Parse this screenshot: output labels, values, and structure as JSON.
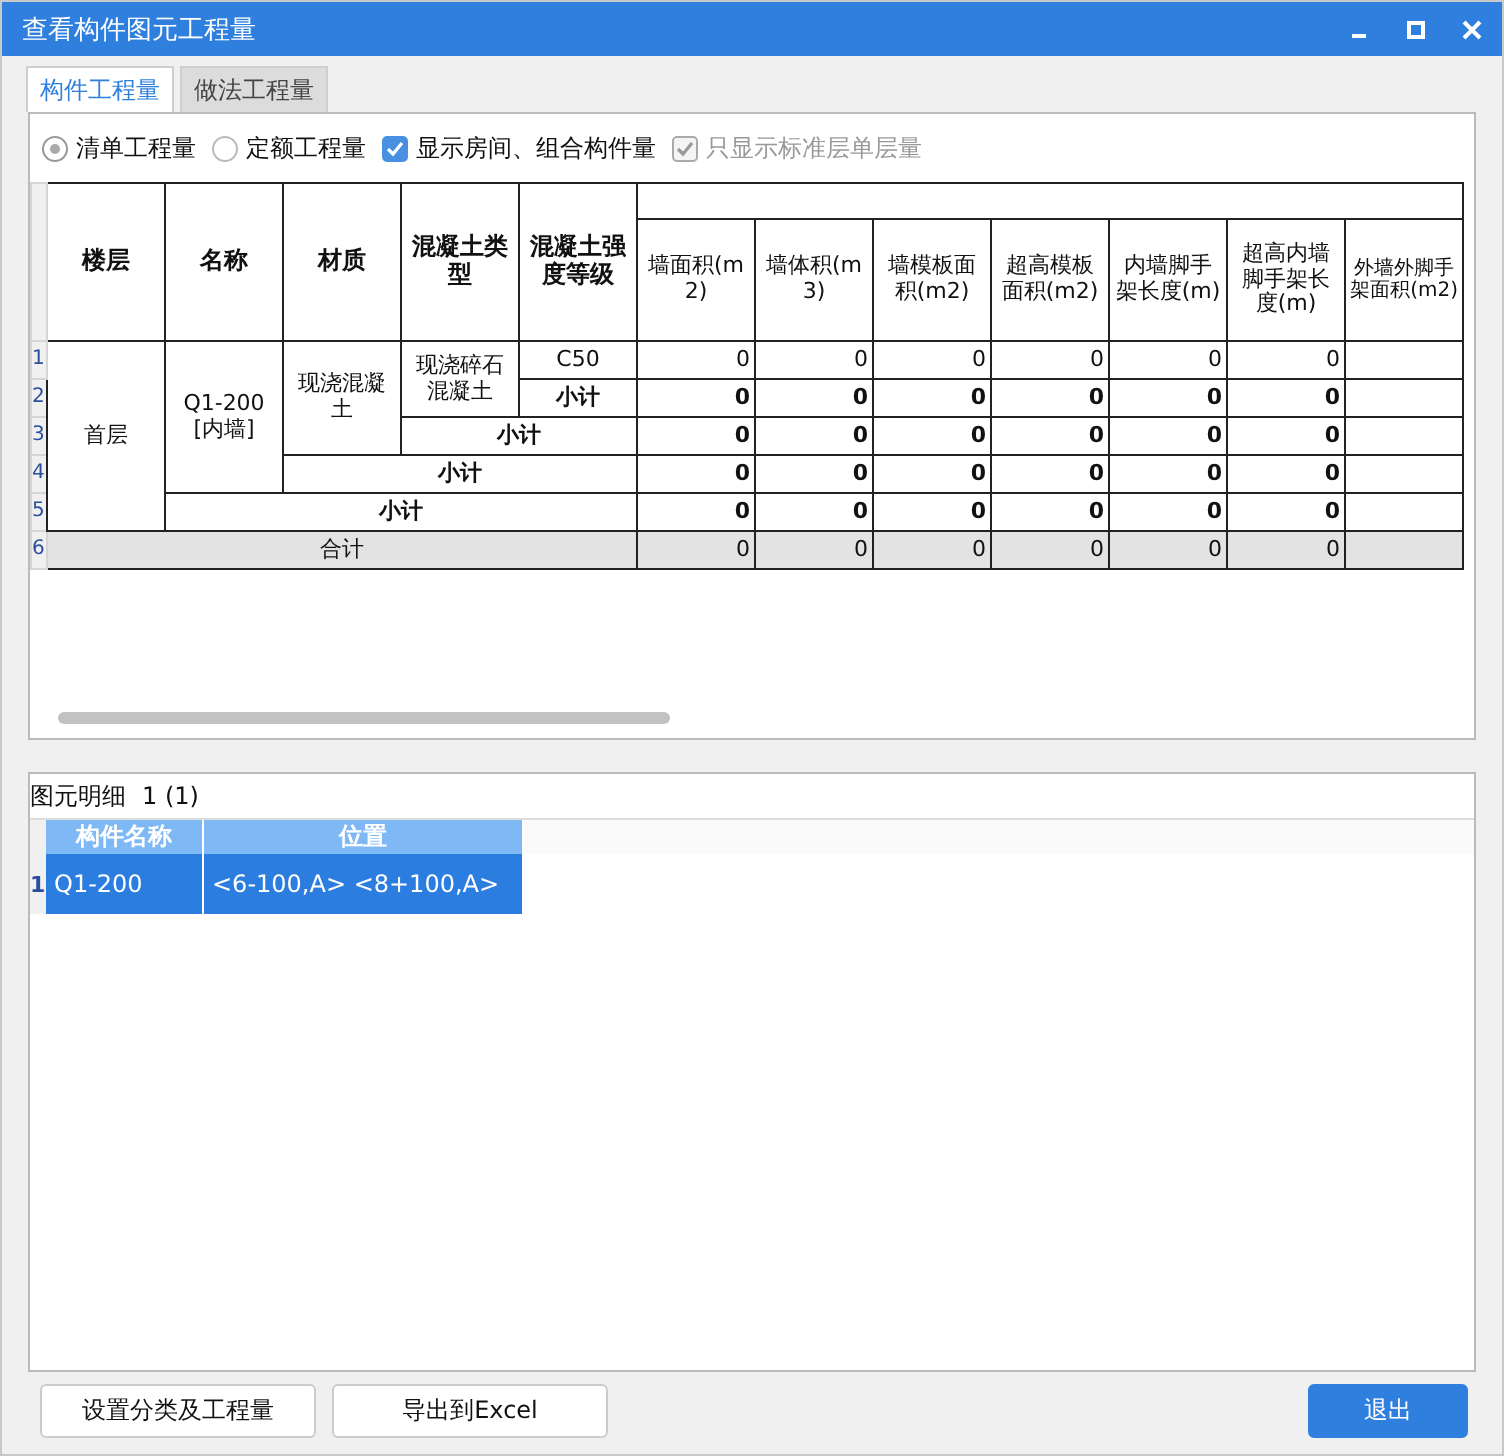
{
  "window": {
    "title": "查看构件图元工程量"
  },
  "tabs": [
    {
      "label": "构件工程量",
      "selected": true
    },
    {
      "label": "做法工程量",
      "selected": false
    }
  ],
  "options": [
    {
      "kind": "radio",
      "label": "清单工程量",
      "selected": true,
      "disabled": false
    },
    {
      "kind": "radio",
      "label": "定额工程量",
      "selected": false,
      "disabled": false
    },
    {
      "kind": "checkbox",
      "label": "显示房间、组合构件量",
      "checked": true,
      "disabled": false
    },
    {
      "kind": "checkbox",
      "label": "只显示标准层单层量",
      "checked": true,
      "disabled": true
    }
  ],
  "table": {
    "columns": [
      "楼层",
      "名称",
      "材质",
      "混凝土类型",
      "混凝土强度等级",
      "墙面积(m2)",
      "墙体积(m3)",
      "墙模板面积(m2)",
      "超高模板面积(m2)",
      "内墙脚手架长度(m)",
      "超高内墙脚手架长度(m)",
      "外墙外脚手架面积(m2)"
    ],
    "rows": [
      {
        "num": "1",
        "kind": "detail",
        "floor": "首层",
        "name": "Q1-200 [内墙]",
        "material": "现浇混凝土",
        "type": "现浇碎石混凝土",
        "grade": "C50",
        "values": [
          "0",
          "0",
          "0",
          "0",
          "0",
          "0"
        ]
      },
      {
        "num": "2",
        "kind": "grade_subtotal",
        "label": "小计",
        "values": [
          "0",
          "0",
          "0",
          "0",
          "0",
          "0"
        ]
      },
      {
        "num": "3",
        "kind": "type_subtotal",
        "label": "小计",
        "values": [
          "0",
          "0",
          "0",
          "0",
          "0",
          "0"
        ]
      },
      {
        "num": "4",
        "kind": "material_subtotal",
        "label": "小计",
        "values": [
          "0",
          "0",
          "0",
          "0",
          "0",
          "0"
        ]
      },
      {
        "num": "5",
        "kind": "name_subtotal",
        "label": "小计",
        "values": [
          "0",
          "0",
          "0",
          "0",
          "0",
          "0"
        ]
      },
      {
        "num": "6",
        "kind": "total",
        "label": "合计",
        "values": [
          "0",
          "0",
          "0",
          "0",
          "0",
          "0"
        ]
      }
    ]
  },
  "detail": {
    "title": "图元明细",
    "count": "1 (1)",
    "columns": [
      "构件名称",
      "位置"
    ],
    "rows": [
      {
        "num": "1",
        "selected": true,
        "cells": [
          "Q1-200",
          "<6-100,A> <8+100,A>"
        ]
      }
    ]
  },
  "buttons": [
    {
      "label": "设置分类及工程量",
      "kind": "normal"
    },
    {
      "label": "导出到Excel",
      "kind": "normal"
    },
    {
      "label": "退出",
      "kind": "primary"
    }
  ]
}
